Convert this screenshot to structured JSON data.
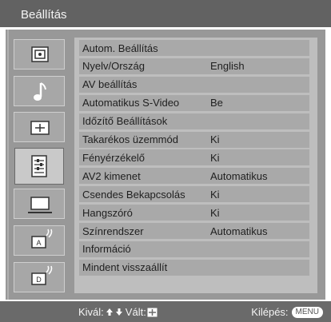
{
  "title": "Beállítás",
  "menu_items": [
    {
      "label": "Autom. Beállítás",
      "value": ""
    },
    {
      "label": "Nyelv/Ország",
      "value": "English"
    },
    {
      "label": "AV beállítás",
      "value": ""
    },
    {
      "label": "Automatikus S-Video",
      "value": "Be"
    },
    {
      "label": "Időzítő Beállítások",
      "value": ""
    },
    {
      "label": "Takarékos üzemmód",
      "value": "Ki"
    },
    {
      "label": "Fényérzékelő",
      "value": "Ki"
    },
    {
      "label": "AV2 kimenet",
      "value": "Automatikus"
    },
    {
      "label": "Csendes Bekapcsolás",
      "value": "Ki"
    },
    {
      "label": "Hangszóró",
      "value": "Ki"
    },
    {
      "label": "Színrendszer",
      "value": "Automatikus"
    },
    {
      "label": "Információ",
      "value": ""
    },
    {
      "label": "Mindent visszaállít",
      "value": ""
    }
  ],
  "sidebar_icons": [
    "picture-icon",
    "music-note-icon",
    "screen-icon",
    "settings-icon",
    "monitor-icon",
    "analog-input-icon",
    "digital-input-icon"
  ],
  "footer": {
    "select": "Kivál:",
    "set": "Vált:",
    "exit": "Kilépés:",
    "menu_badge": "MENU"
  },
  "colors": {
    "title_bar": "#626262",
    "frame": "#989898",
    "panel": "#bebebe",
    "row_dark": "#a9a9a9",
    "row_light": "#bebebe"
  }
}
